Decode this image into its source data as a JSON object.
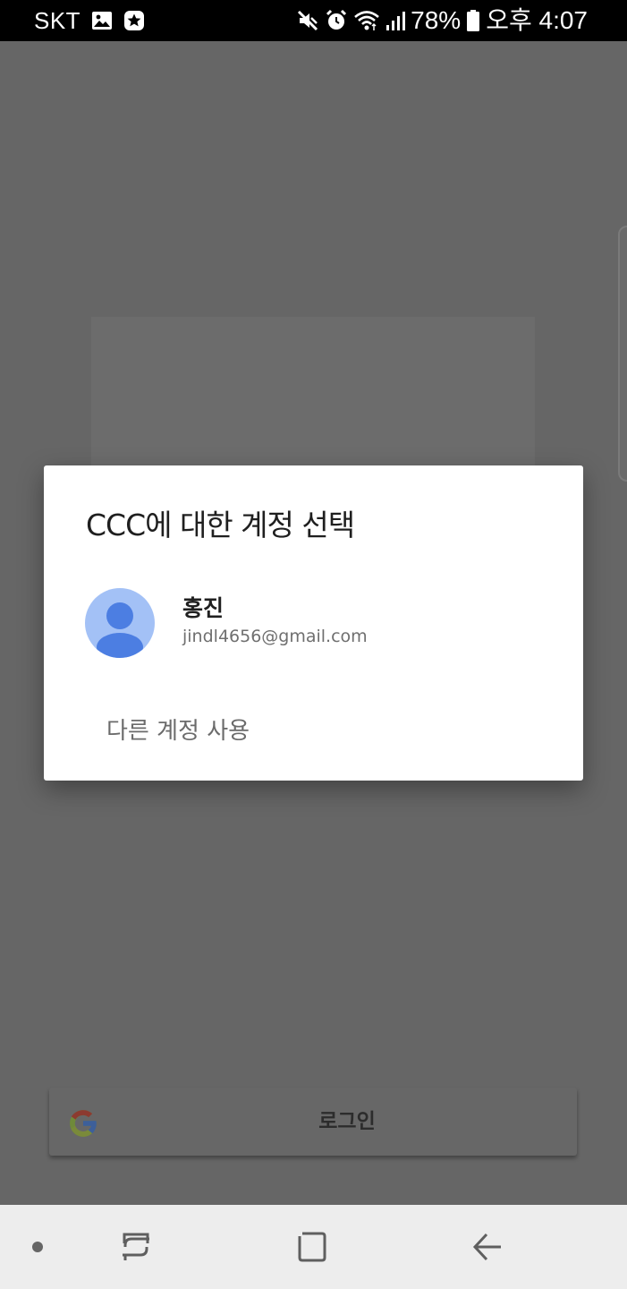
{
  "status_bar": {
    "carrier": "SKT",
    "battery": "78%",
    "time": "오후 4:07",
    "left_icons": [
      "image-icon",
      "notification-badge-icon"
    ],
    "right_icons": [
      "mute-icon",
      "alarm-icon",
      "wifi-icon",
      "signal-icon",
      "battery-icon"
    ]
  },
  "dialog": {
    "title": "CCC에 대한 계정 선택",
    "account": {
      "name": "홍진",
      "email": "jindl4656@gmail.com",
      "avatar_color": "#a3c1f6",
      "avatar_figure_color": "#4c7ee2"
    },
    "use_other_account": "다른 계정 사용"
  },
  "background_app": {
    "sign_in_button_label": "로그인",
    "sign_in_icon": "google-logo-icon"
  },
  "nav_bar": {
    "items": [
      "dot-icon",
      "recent-apps-icon",
      "home-icon",
      "back-icon"
    ]
  },
  "colors": {
    "scrim": "#666666",
    "status_bar": "#000000",
    "dialog_background": "#ffffff",
    "nav_bar": "#ededed"
  }
}
